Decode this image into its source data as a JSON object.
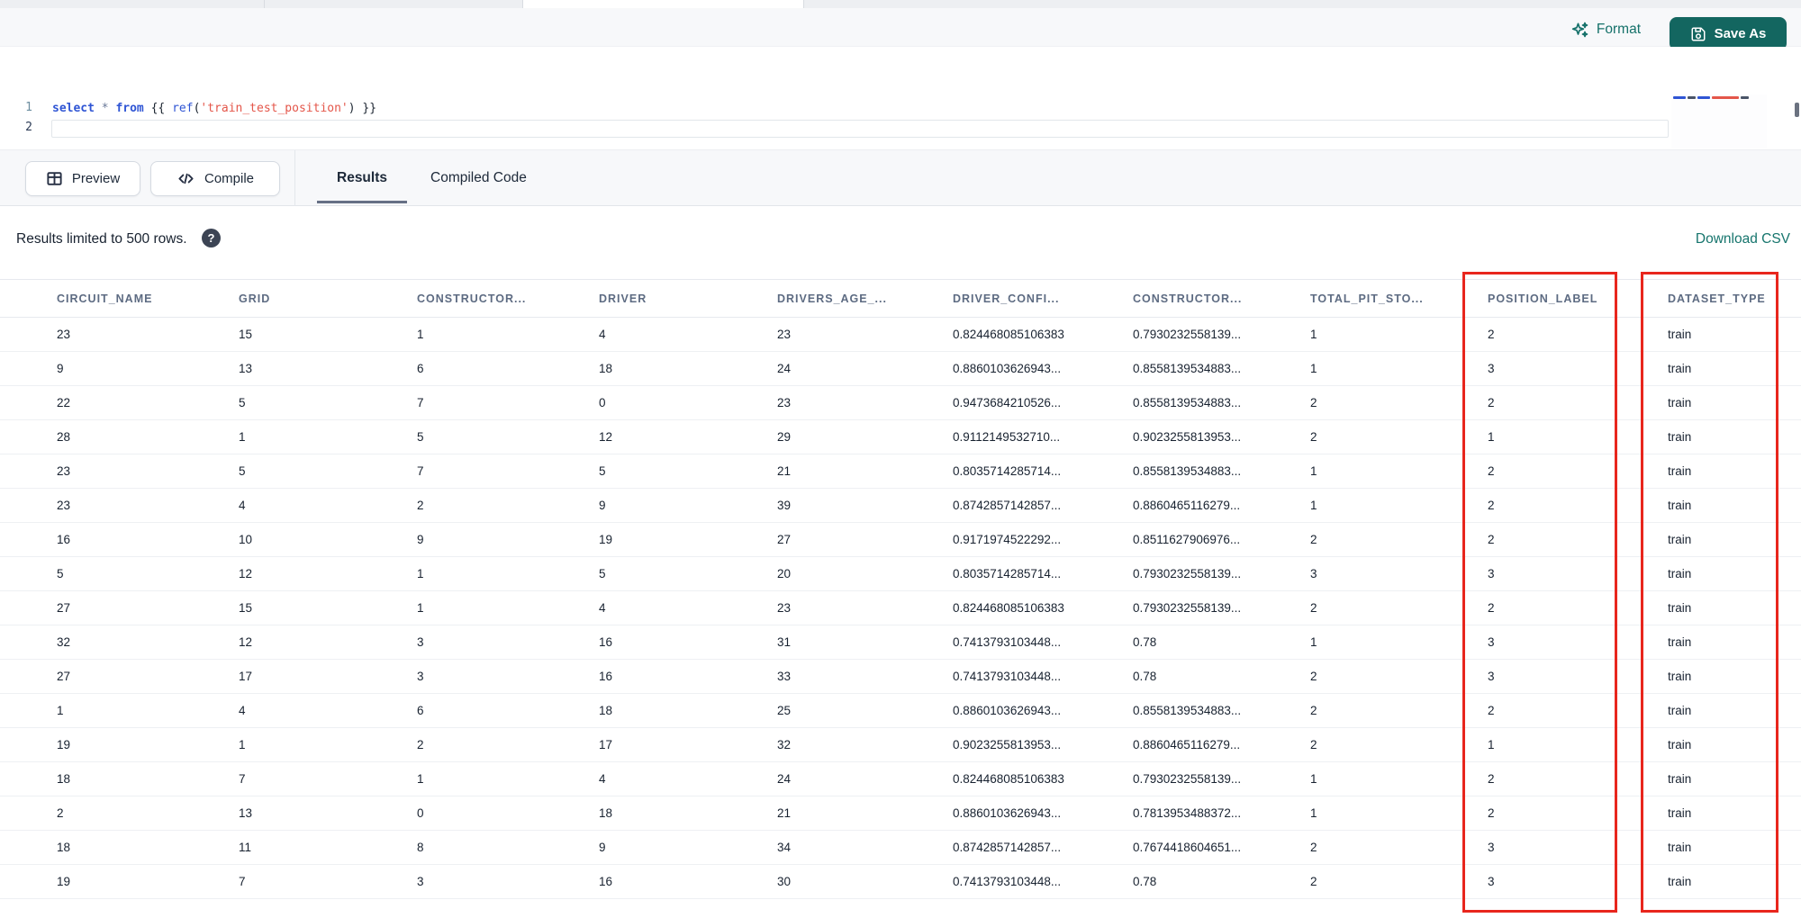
{
  "colors": {
    "accent_teal": "#15716a",
    "save_button_bg": "#136660",
    "annotation_red": "#e8261d",
    "keyword_blue": "#2f55d4",
    "string_red": "#e4564a"
  },
  "toolbar": {
    "format_label": "Format",
    "save_as_label": "Save As"
  },
  "editor": {
    "lines": [
      {
        "number": "1",
        "tokens": [
          {
            "text": "select",
            "type": "kw"
          },
          {
            "text": " ",
            "type": "plain"
          },
          {
            "text": "*",
            "type": "op"
          },
          {
            "text": " ",
            "type": "plain"
          },
          {
            "text": "from",
            "type": "kw"
          },
          {
            "text": " ",
            "type": "plain"
          },
          {
            "text": "{{ ",
            "type": "brace"
          },
          {
            "text": "ref",
            "type": "fn"
          },
          {
            "text": "(",
            "type": "brace"
          },
          {
            "text": "'train_test_position'",
            "type": "str"
          },
          {
            "text": ")",
            "type": "brace"
          },
          {
            "text": " }}",
            "type": "brace"
          }
        ]
      },
      {
        "number": "2",
        "tokens": []
      }
    ]
  },
  "action_bar": {
    "preview_label": "Preview",
    "compile_label": "Compile",
    "tabs": [
      {
        "label": "Results",
        "active": true
      },
      {
        "label": "Compiled Code",
        "active": false
      }
    ]
  },
  "results_meta": {
    "limit_text": "Results limited to 500 rows.",
    "help_icon_glyph": "?",
    "download_label": "Download CSV"
  },
  "table": {
    "columns": [
      "CIRCUIT_NAME",
      "GRID",
      "CONSTRUCTOR...",
      "DRIVER",
      "DRIVERS_AGE_...",
      "DRIVER_CONFI...",
      "CONSTRUCTOR...",
      "TOTAL_PIT_STO...",
      "POSITION_LABEL",
      "DATASET_TYPE"
    ],
    "rows": [
      [
        "23",
        "15",
        "1",
        "4",
        "23",
        "0.824468085106383",
        "0.7930232558139...",
        "1",
        "2",
        "train"
      ],
      [
        "9",
        "13",
        "6",
        "18",
        "24",
        "0.8860103626943...",
        "0.8558139534883...",
        "1",
        "3",
        "train"
      ],
      [
        "22",
        "5",
        "7",
        "0",
        "23",
        "0.9473684210526...",
        "0.8558139534883...",
        "2",
        "2",
        "train"
      ],
      [
        "28",
        "1",
        "5",
        "12",
        "29",
        "0.9112149532710...",
        "0.9023255813953...",
        "2",
        "1",
        "train"
      ],
      [
        "23",
        "5",
        "7",
        "5",
        "21",
        "0.8035714285714...",
        "0.8558139534883...",
        "1",
        "2",
        "train"
      ],
      [
        "23",
        "4",
        "2",
        "9",
        "39",
        "0.8742857142857...",
        "0.8860465116279...",
        "1",
        "2",
        "train"
      ],
      [
        "16",
        "10",
        "9",
        "19",
        "27",
        "0.9171974522292...",
        "0.8511627906976...",
        "2",
        "2",
        "train"
      ],
      [
        "5",
        "12",
        "1",
        "5",
        "20",
        "0.8035714285714...",
        "0.7930232558139...",
        "3",
        "3",
        "train"
      ],
      [
        "27",
        "15",
        "1",
        "4",
        "23",
        "0.824468085106383",
        "0.7930232558139...",
        "2",
        "2",
        "train"
      ],
      [
        "32",
        "12",
        "3",
        "16",
        "31",
        "0.7413793103448...",
        "0.78",
        "1",
        "3",
        "train"
      ],
      [
        "27",
        "17",
        "3",
        "16",
        "33",
        "0.7413793103448...",
        "0.78",
        "2",
        "3",
        "train"
      ],
      [
        "1",
        "4",
        "6",
        "18",
        "25",
        "0.8860103626943...",
        "0.8558139534883...",
        "2",
        "2",
        "train"
      ],
      [
        "19",
        "1",
        "2",
        "17",
        "32",
        "0.9023255813953...",
        "0.8860465116279...",
        "2",
        "1",
        "train"
      ],
      [
        "18",
        "7",
        "1",
        "4",
        "24",
        "0.824468085106383",
        "0.7930232558139...",
        "1",
        "2",
        "train"
      ],
      [
        "2",
        "13",
        "0",
        "18",
        "21",
        "0.8860103626943...",
        "0.7813953488372...",
        "1",
        "2",
        "train"
      ],
      [
        "18",
        "11",
        "8",
        "9",
        "34",
        "0.8742857142857...",
        "0.7674418604651...",
        "2",
        "3",
        "train"
      ],
      [
        "19",
        "7",
        "3",
        "16",
        "30",
        "0.7413793103448...",
        "0.78",
        "2",
        "3",
        "train"
      ]
    ]
  },
  "annotations": {
    "highlighted_columns": [
      "POSITION_LABEL",
      "DATASET_TYPE"
    ]
  }
}
